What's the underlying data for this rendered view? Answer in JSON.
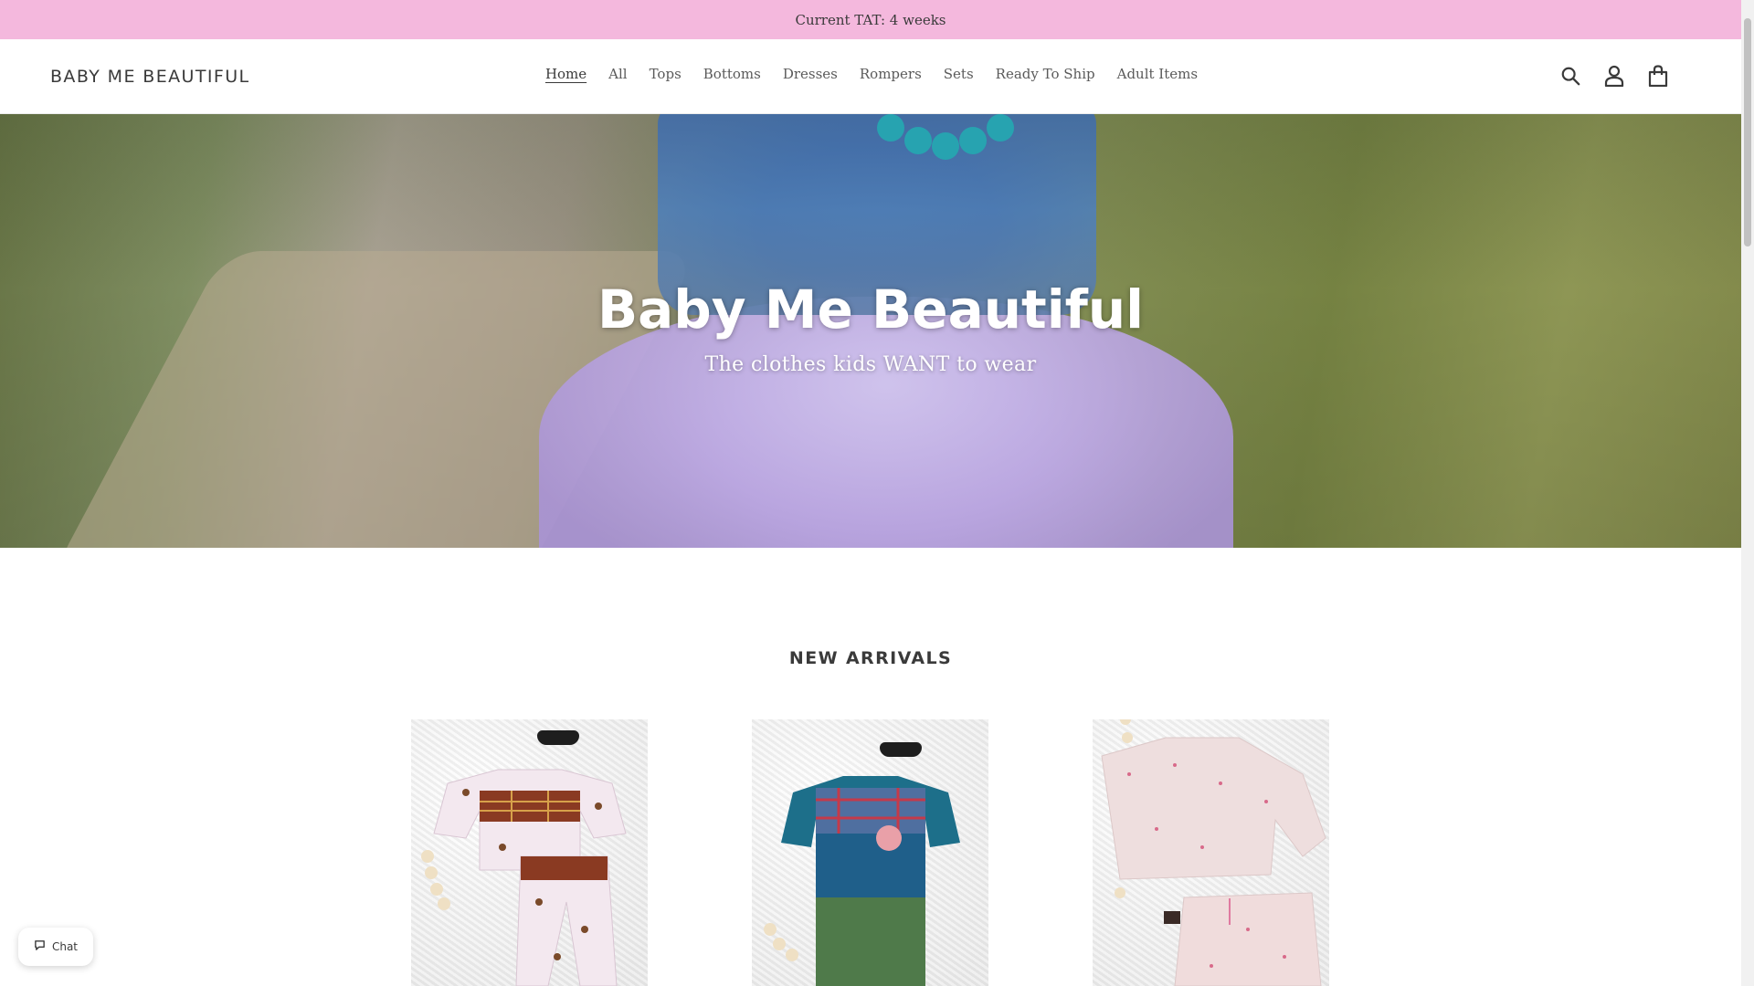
{
  "announcement": {
    "text": "Current TAT: 4 weeks"
  },
  "header": {
    "logo": "BABY ME BEAUTIFUL",
    "nav": [
      {
        "label": "Home",
        "active": true
      },
      {
        "label": "All",
        "active": false
      },
      {
        "label": "Tops",
        "active": false
      },
      {
        "label": "Bottoms",
        "active": false
      },
      {
        "label": "Dresses",
        "active": false
      },
      {
        "label": "Rompers",
        "active": false
      },
      {
        "label": "Sets",
        "active": false
      },
      {
        "label": "Ready To Ship",
        "active": false
      },
      {
        "label": "Adult Items",
        "active": false
      }
    ],
    "icons": [
      "search-icon",
      "account-icon",
      "cart-icon"
    ]
  },
  "hero": {
    "title": "Baby Me Beautiful",
    "subtitle": "The clothes kids WANT to wear"
  },
  "new_arrivals": {
    "title": "NEW ARRIVALS"
  },
  "chat": {
    "label": "Chat"
  },
  "colors": {
    "announcement_bg": "#f4b8dd",
    "text": "#3a3a3a"
  }
}
